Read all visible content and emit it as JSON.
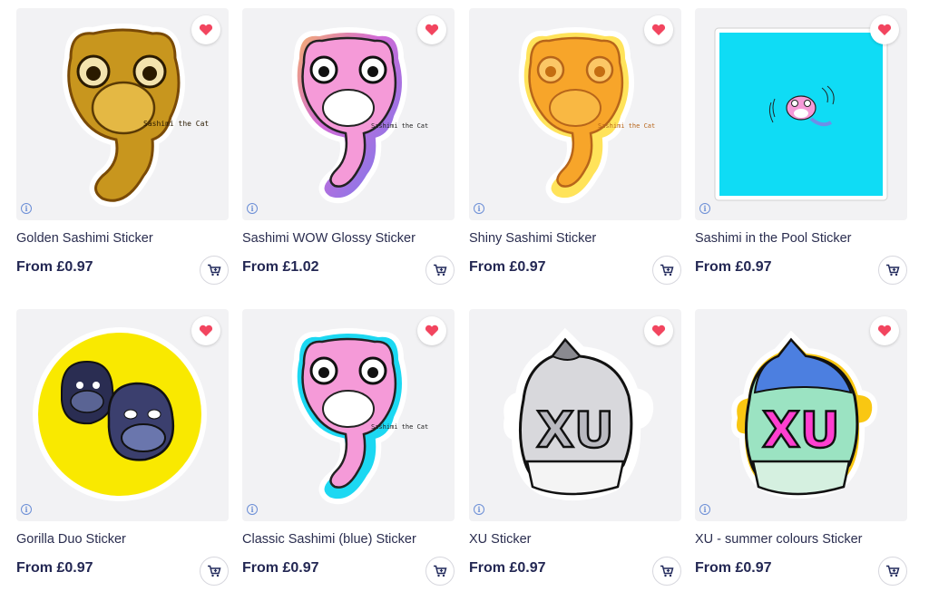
{
  "products": [
    {
      "title": "Golden Sashimi Sticker",
      "price": "From £0.97",
      "icon": "golden-cat-sticker"
    },
    {
      "title": "Sashimi WOW Glossy Sticker",
      "price": "From £1.02",
      "icon": "pink-cat-holographic-sticker"
    },
    {
      "title": "Shiny Sashimi Sticker",
      "price": "From £0.97",
      "icon": "orange-cat-sticker"
    },
    {
      "title": "Sashimi in the Pool Sticker",
      "price": "From £0.97",
      "icon": "cat-in-pool-sticker"
    },
    {
      "title": "Gorilla Duo Sticker",
      "price": "From £0.97",
      "icon": "gorilla-duo-sticker"
    },
    {
      "title": "Classic Sashimi (blue) Sticker",
      "price": "From £0.97",
      "icon": "pink-cat-blue-outline-sticker"
    },
    {
      "title": "XU Sticker",
      "price": "From £0.97",
      "icon": "xu-grey-sticker"
    },
    {
      "title": "XU - summer colours Sticker",
      "price": "From £0.97",
      "icon": "xu-summer-sticker"
    }
  ],
  "sticker_caption": "Sashimi the Cat",
  "xu_text": "XU",
  "colors": {
    "heart": "#f2455f",
    "price_text": "#232753",
    "info_icon": "#6b8ed6",
    "thumb_bg": "#f2f2f4"
  }
}
